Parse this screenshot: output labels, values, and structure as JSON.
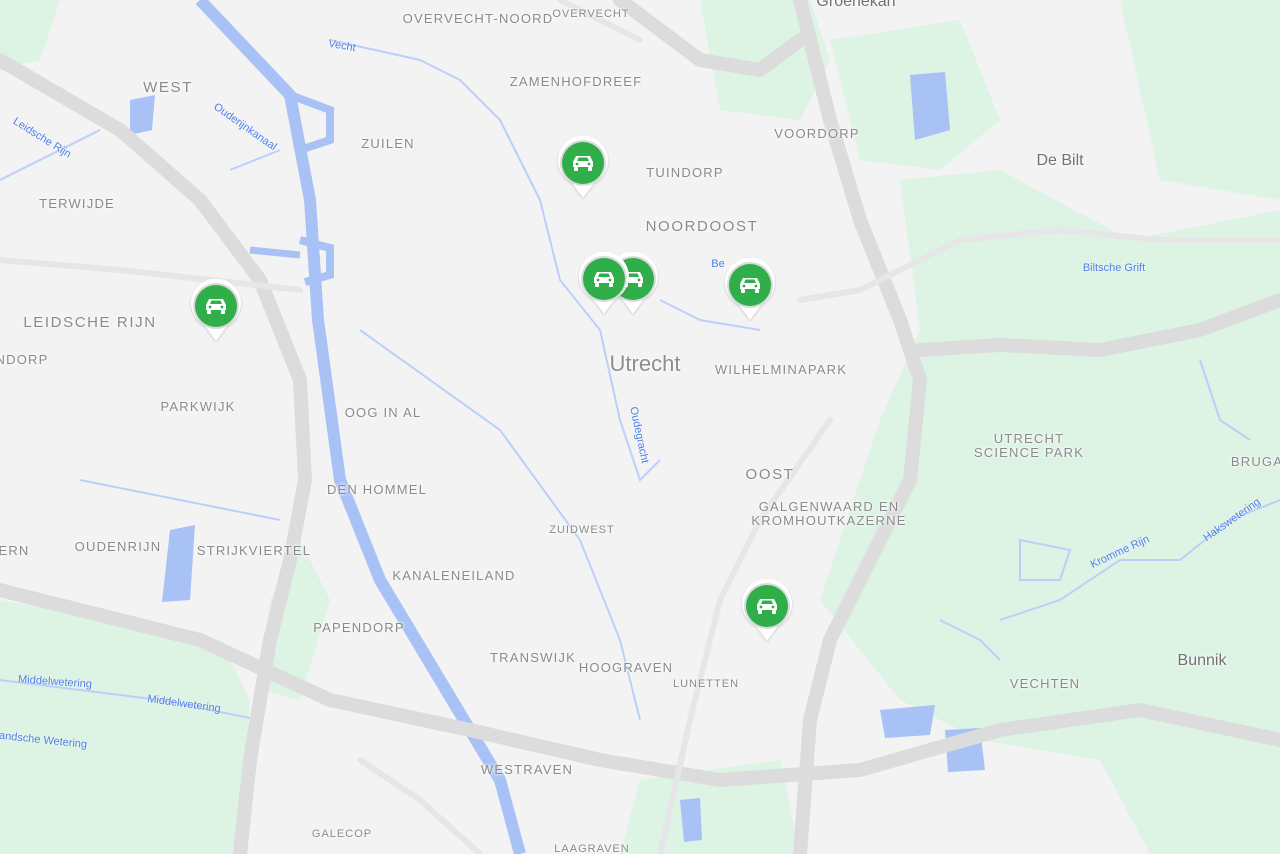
{
  "map": {
    "city": "Utrecht",
    "districts": [
      "Overvecht-Noord",
      "Overvecht",
      "Zamenhofdreef",
      "West",
      "Zuilen",
      "Tuindorp",
      "Voordorp",
      "Noordoost",
      "Terwijde",
      "Leidsche Rijn",
      "Wilhelminapark",
      "Ndorp",
      "Parkwijk",
      "Oog in Al",
      "Oost",
      "Utrecht Science Park",
      "Bruga",
      "Den Hommel",
      "Galgenwaard en Kromhoutkazerne",
      "Zuidwest",
      "Ern",
      "Oudenrijn",
      "Strijkviertel",
      "Kanaleneiland",
      "Papendorp",
      "Transwijk",
      "Hoograven",
      "Lunetten",
      "Vechten",
      "Westraven",
      "Galecop",
      "Laagraven"
    ],
    "towns": [
      "De Bilt",
      "Bunnik",
      "Groenekan"
    ],
    "waterways": [
      "Vecht",
      "Leidsche Rijn",
      "Ouderijnkanaal",
      "Oudegracht",
      "Biltsche Grift",
      "Kromme Rijn",
      "Hakswetering",
      "Middelwetering",
      "Middelwetering",
      "Landsche Wetering",
      "Be"
    ]
  },
  "markers": [
    {
      "name": "car-marker-1",
      "icon": "car-icon",
      "color": "#2fae4a"
    },
    {
      "name": "car-marker-2",
      "icon": "car-icon",
      "color": "#2fae4a"
    },
    {
      "name": "car-marker-3",
      "icon": "car-icon",
      "color": "#2fae4a"
    },
    {
      "name": "car-marker-4",
      "icon": "car-icon",
      "color": "#2fae4a"
    },
    {
      "name": "car-marker-5",
      "icon": "car-icon",
      "color": "#2fae4a"
    },
    {
      "name": "car-marker-6",
      "icon": "car-icon",
      "color": "#2fae4a"
    }
  ],
  "colors": {
    "land": "#f3f3f4",
    "green": "#ddf3e4",
    "water": "#a9c2f5",
    "road": "#d6d6d6",
    "marker": "#2fae4a"
  }
}
